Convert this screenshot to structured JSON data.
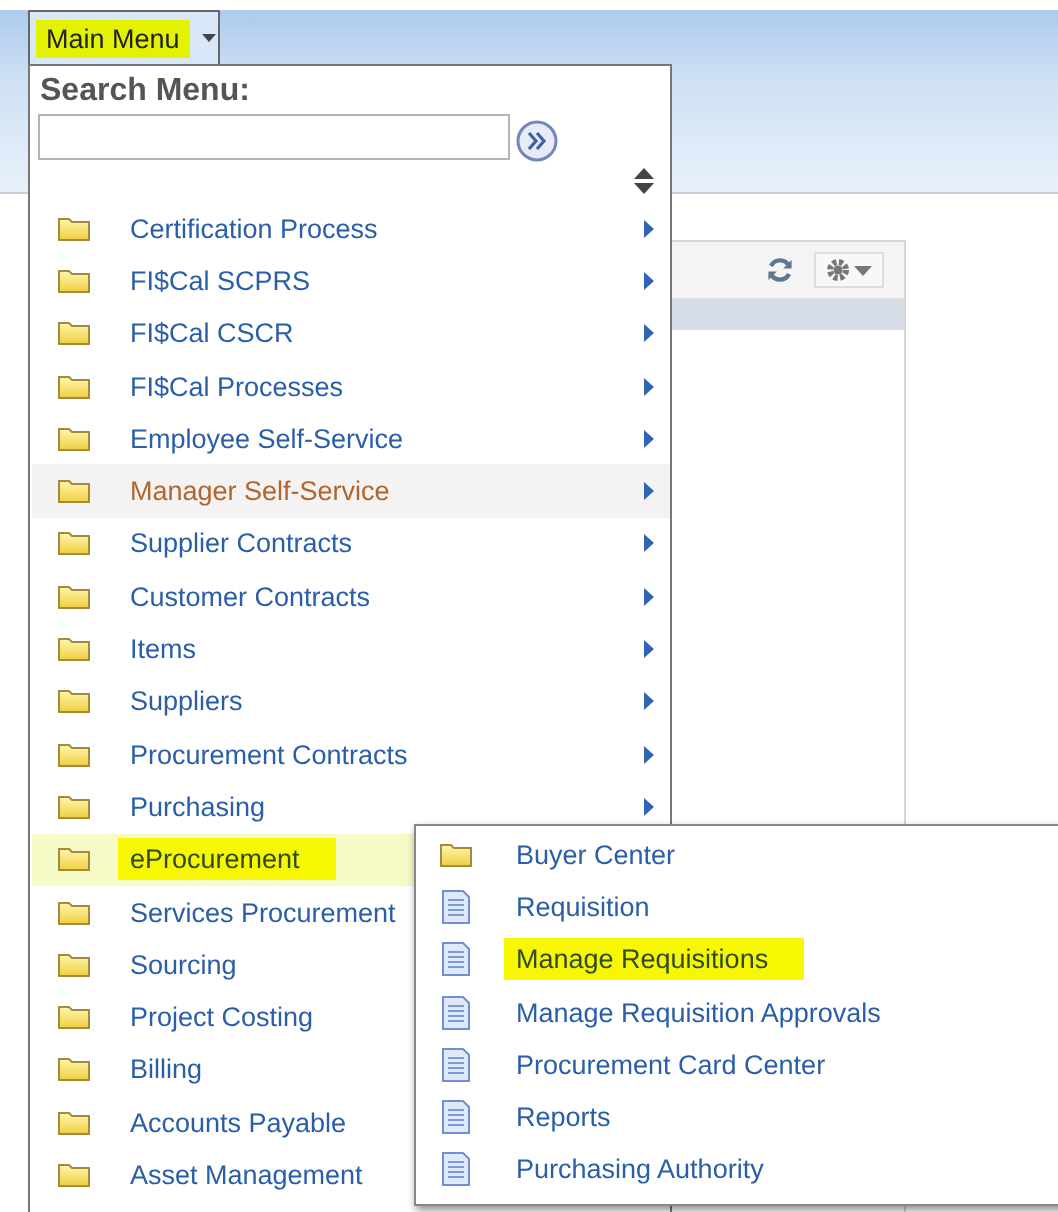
{
  "menu_button": {
    "label": "Main Menu",
    "highlighted": true
  },
  "search": {
    "label": "Search Menu:"
  },
  "menu_items": [
    {
      "label": "Certification Process",
      "kind": "folder",
      "hovered": false,
      "selected": false,
      "highlighted": false
    },
    {
      "label": "FI$Cal SCPRS",
      "kind": "folder",
      "hovered": false,
      "selected": false,
      "highlighted": false
    },
    {
      "label": "FI$Cal CSCR",
      "kind": "folder",
      "hovered": false,
      "selected": false,
      "highlighted": false
    },
    {
      "label": "FI$Cal Processes",
      "kind": "folder",
      "hovered": false,
      "selected": false,
      "highlighted": false
    },
    {
      "label": "Employee Self-Service",
      "kind": "folder",
      "hovered": false,
      "selected": false,
      "highlighted": false
    },
    {
      "label": "Manager Self-Service",
      "kind": "folder",
      "hovered": true,
      "selected": false,
      "highlighted": false
    },
    {
      "label": "Supplier Contracts",
      "kind": "folder",
      "hovered": false,
      "selected": false,
      "highlighted": false
    },
    {
      "label": "Customer Contracts",
      "kind": "folder",
      "hovered": false,
      "selected": false,
      "highlighted": false
    },
    {
      "label": "Items",
      "kind": "folder",
      "hovered": false,
      "selected": false,
      "highlighted": false
    },
    {
      "label": "Suppliers",
      "kind": "folder",
      "hovered": false,
      "selected": false,
      "highlighted": false
    },
    {
      "label": "Procurement Contracts",
      "kind": "folder",
      "hovered": false,
      "selected": false,
      "highlighted": false
    },
    {
      "label": "Purchasing",
      "kind": "folder",
      "hovered": false,
      "selected": false,
      "highlighted": false
    },
    {
      "label": "eProcurement",
      "kind": "folder",
      "hovered": false,
      "selected": true,
      "highlighted": true
    },
    {
      "label": "Services Procurement",
      "kind": "folder",
      "hovered": false,
      "selected": false,
      "highlighted": false
    },
    {
      "label": "Sourcing",
      "kind": "folder",
      "hovered": false,
      "selected": false,
      "highlighted": false
    },
    {
      "label": "Project Costing",
      "kind": "folder",
      "hovered": false,
      "selected": false,
      "highlighted": false
    },
    {
      "label": "Billing",
      "kind": "folder",
      "hovered": false,
      "selected": false,
      "highlighted": false
    },
    {
      "label": "Accounts Payable",
      "kind": "folder",
      "hovered": false,
      "selected": false,
      "highlighted": false
    },
    {
      "label": "Asset Management",
      "kind": "folder",
      "hovered": false,
      "selected": false,
      "highlighted": false
    }
  ],
  "submenu": {
    "items": [
      {
        "label": "Buyer Center",
        "kind": "folder",
        "highlighted": false
      },
      {
        "label": "Requisition",
        "kind": "page",
        "highlighted": false
      },
      {
        "label": "Manage Requisitions",
        "kind": "page",
        "highlighted": true
      },
      {
        "label": "Manage Requisition Approvals",
        "kind": "page",
        "highlighted": false
      },
      {
        "label": "Procurement Card Center",
        "kind": "page",
        "highlighted": false
      },
      {
        "label": "Reports",
        "kind": "page",
        "highlighted": false
      },
      {
        "label": "Purchasing Authority",
        "kind": "page",
        "highlighted": false
      }
    ]
  }
}
